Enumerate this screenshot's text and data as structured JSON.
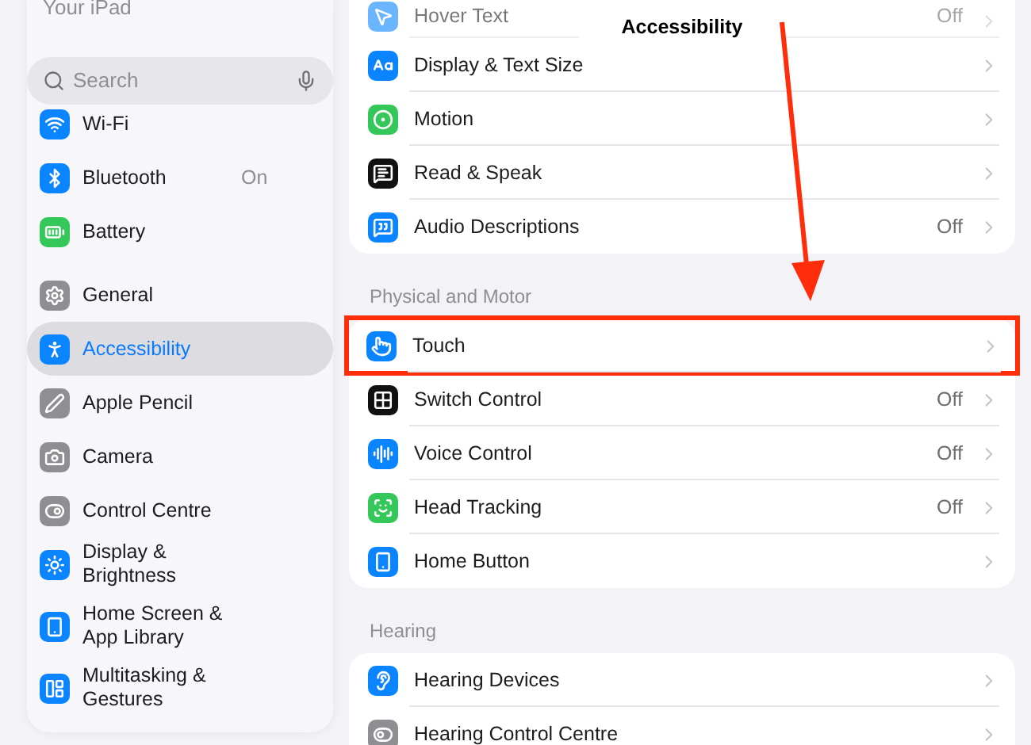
{
  "nav_bar": {
    "title": "Accessibility"
  },
  "sidebar": {
    "header": {
      "label": "Your iPad",
      "dimmed": true
    },
    "search": {
      "placeholder": "Search"
    },
    "groups": [
      {
        "items": [
          {
            "label": "Wi-Fi",
            "selected": false
          },
          {
            "label": "Bluetooth",
            "value": "On",
            "selected": false
          },
          {
            "label": "Battery",
            "selected": false
          }
        ]
      },
      {
        "items": [
          {
            "label": "General",
            "selected": false
          },
          {
            "label": "Accessibility",
            "selected": true
          },
          {
            "label": "Apple Pencil",
            "selected": false
          },
          {
            "label": "Camera",
            "selected": false
          },
          {
            "label": "Control Centre",
            "selected": false
          },
          {
            "label": "Display & Brightness",
            "selected": false
          },
          {
            "label": "Home Screen & App Library",
            "selected": false
          },
          {
            "label": "Multitasking & Gestures",
            "selected": false
          }
        ]
      }
    ]
  },
  "sections": [
    {
      "rows": [
        {
          "label": "Hover Text",
          "value": "Off",
          "dimmed": true,
          "highlighted": false
        },
        {
          "label": "Display & Text Size",
          "dimmed": false,
          "highlighted": false
        },
        {
          "label": "Motion",
          "dimmed": false,
          "highlighted": false
        },
        {
          "label": "Read & Speak",
          "dimmed": false,
          "highlighted": false
        },
        {
          "label": "Audio Descriptions",
          "value": "Off",
          "dimmed": false,
          "highlighted": false
        }
      ]
    },
    {
      "header": "Physical and Motor",
      "rows": [
        {
          "label": "Touch",
          "dimmed": false,
          "highlighted": true
        },
        {
          "label": "Switch Control",
          "value": "Off",
          "dimmed": false,
          "highlighted": false
        },
        {
          "label": "Voice Control",
          "value": "Off",
          "dimmed": false,
          "highlighted": false
        },
        {
          "label": "Head Tracking",
          "value": "Off",
          "dimmed": false,
          "highlighted": false
        },
        {
          "label": "Home Button",
          "dimmed": false,
          "highlighted": false
        }
      ]
    },
    {
      "header": "Hearing",
      "rows": [
        {
          "label": "Hearing Devices",
          "dimmed": false,
          "highlighted": false
        },
        {
          "label": "Hearing Control Centre",
          "dimmed": false,
          "highlighted": false
        }
      ]
    }
  ]
}
